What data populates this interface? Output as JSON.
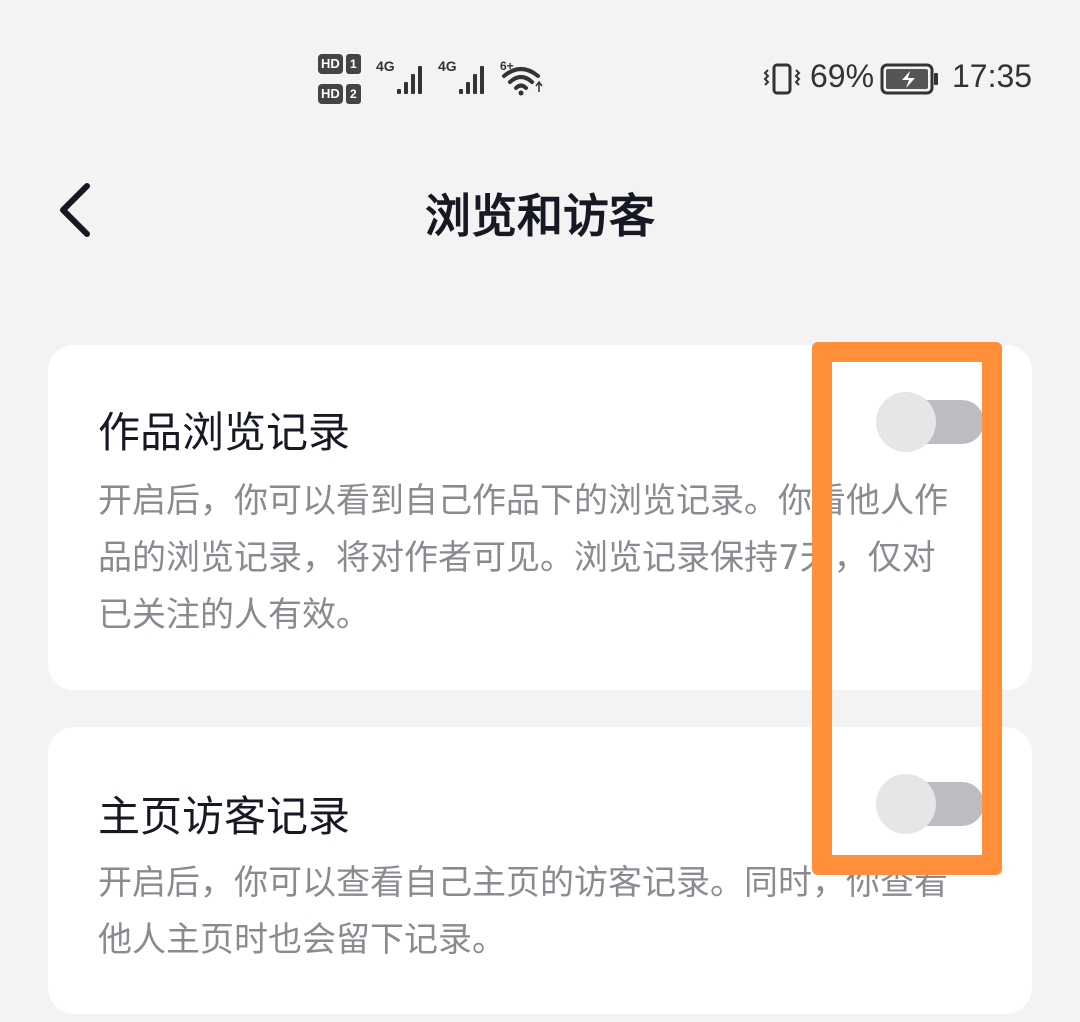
{
  "status_bar": {
    "sim1_hd": "HD",
    "sim1_num": "1",
    "sim2_hd": "HD",
    "sim2_num": "2",
    "signal1_label": "4G",
    "signal2_label": "4G",
    "wifi_label": "6+",
    "battery_percent": "69%",
    "time": "17:35",
    "icons": [
      "signal-icon",
      "wifi-icon",
      "vibrate-icon",
      "battery-charging-icon"
    ]
  },
  "header": {
    "back_icon": "chevron-left-icon",
    "title": "浏览和访客"
  },
  "settings": [
    {
      "title": "作品浏览记录",
      "description": "开启后，你可以看到自己作品下的浏览记录。你看他人作品的浏览记录，将对作者可见。浏览记录保持7天，仅对已关注的人有效。",
      "enabled": false
    },
    {
      "title": "主页访客记录",
      "description": "开启后，你可以查看自己主页的访客记录。同时，你查看他人主页时也会留下记录。",
      "enabled": false
    }
  ],
  "colors": {
    "background": "#f3f3f3",
    "card": "#ffffff",
    "title_text": "#161823",
    "desc_text": "#8a8b91",
    "toggle_track_off": "#bdbdc1",
    "toggle_knob": "#e6e6e8",
    "highlight": "#ff8f3a"
  }
}
